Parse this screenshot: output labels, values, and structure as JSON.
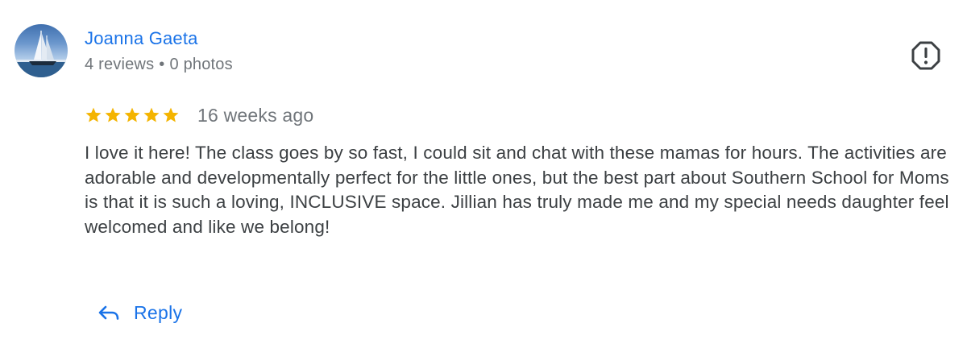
{
  "author": {
    "name": "Joanna Gaeta",
    "reviews": "4 reviews",
    "separator": "•",
    "photos": "0 photos"
  },
  "review": {
    "rating": 5,
    "rating_max": 5,
    "date": "16 weeks ago",
    "text": "I love it here! The class goes by so fast, I could sit and chat with these mamas for hours. The activities are adorable and developmentally perfect for the little ones, but the best part about Southern School for Moms is that it is such a loving, INCLUSIVE space. Jillian has truly made me and my special needs daughter feel welcomed and like we belong!"
  },
  "actions": {
    "reply_label": "Reply"
  },
  "icons": {
    "avatar": "sailboat-avatar",
    "flag": "report-icon",
    "star": "star-icon",
    "reply": "reply-arrow-icon"
  },
  "colors": {
    "link_blue": "#1a73e8",
    "star_gold": "#f4b400",
    "meta_gray": "#70757a",
    "text_dark": "#3c4043"
  }
}
